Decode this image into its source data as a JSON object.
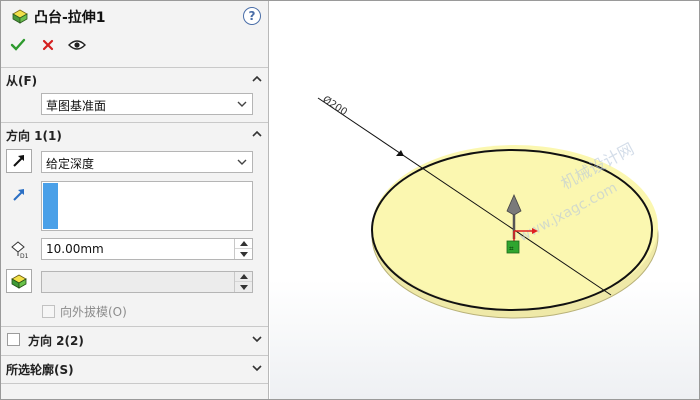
{
  "title": "凸台-拉伸1",
  "help_label": "?",
  "actions": {
    "ok_icon": "checkmark-icon",
    "cancel_icon": "x-icon",
    "preview_icon": "eye-icon"
  },
  "from_section": {
    "label": "从(F)",
    "start_condition": "草图基准面"
  },
  "direction1": {
    "label": "方向 1(1)",
    "end_condition": "给定深度",
    "depth": "10.00mm",
    "draft_label": "向外拔模(O)",
    "draft_checked": false
  },
  "direction2": {
    "label": "方向 2(2)",
    "checked": false
  },
  "selected_contours": {
    "label": "所选轮廓(S)"
  },
  "viewport": {
    "dimension_label": "Ø200",
    "watermark_line1": "机械设计网",
    "watermark_line2": "www.jxagc.com",
    "sketch_fill_color": "#fbf7b0",
    "axis_colors": {
      "x": "#e02020",
      "y": "#2fa52f"
    }
  }
}
